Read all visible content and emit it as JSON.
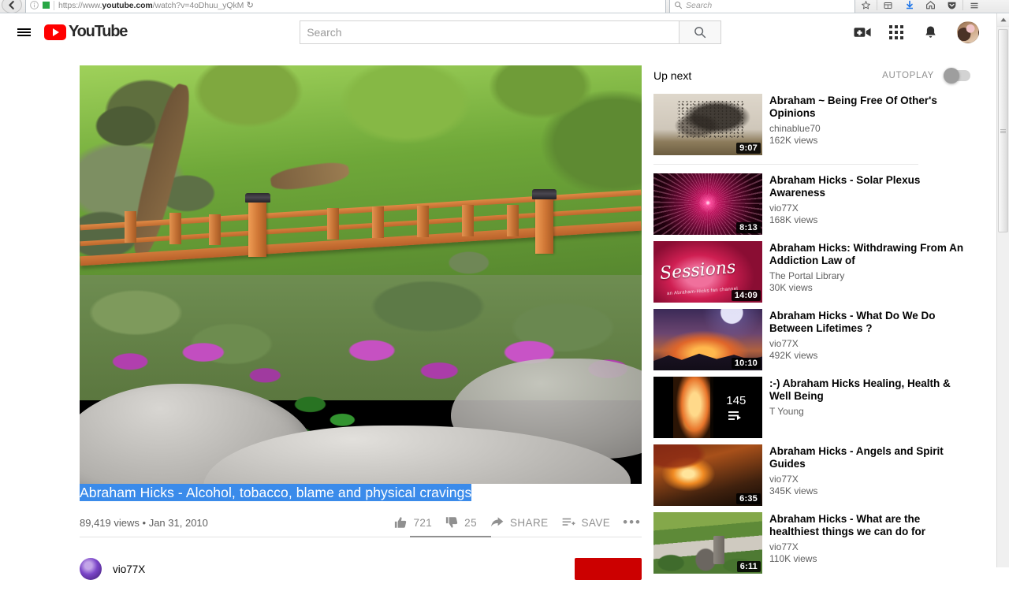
{
  "browser": {
    "url_prefix": "https://www.",
    "url_domain": "youtube.com",
    "url_path": "/watch?v=4oDhuu_yQkM",
    "reload_glyph": "↻",
    "search_placeholder": "Search",
    "icons": {
      "back": "back-arrow-icon",
      "info": "page-info-icon",
      "secure": "secure-indicator",
      "bookmark": "star-icon",
      "library": "library-icon",
      "downloads": "download-arrow-icon",
      "home": "home-icon",
      "pocket": "pocket-icon",
      "menu": "hamburger-menu-icon"
    }
  },
  "masthead": {
    "guide_label": "Guide",
    "logo_text": "YouTube",
    "search_placeholder": "Search",
    "search_value": "",
    "search_button_label": "Search",
    "create_icon": "video-camera-plus-icon",
    "apps_icon": "apps-grid-icon",
    "notifications_icon": "bell-icon",
    "avatar_label": "Account avatar"
  },
  "video": {
    "title": "Abraham Hicks - Alcohol, tobacco, blame and physical cravings",
    "views": "89,419 views",
    "separator": "•",
    "date": "Jan 31, 2010",
    "like_count": "721",
    "dislike_count": "25",
    "share_label": "SHARE",
    "save_label": "SAVE",
    "more_label": "•••",
    "channel_name": "vio77X",
    "subscribe_label": ""
  },
  "sidebar": {
    "heading": "Up next",
    "autoplay_label": "AUTOPLAY",
    "autoplay_on": false,
    "items": [
      {
        "title": "Abraham ~ Being Free Of Other's Opinions",
        "channel": "chinablue70",
        "views": "162K views",
        "duration": "9:07",
        "thumb": "birds",
        "playlist_count": ""
      },
      {
        "title": "Abraham Hicks - Solar Plexus Awareness",
        "channel": "vio77X",
        "views": "168K views",
        "duration": "8:13",
        "thumb": "plexus",
        "playlist_count": ""
      },
      {
        "title": "Abraham Hicks: Withdrawing From An Addiction Law of",
        "channel": "The Portal Library",
        "views": "30K views",
        "duration": "14:09",
        "thumb": "rose",
        "thumb_text": "Sessions",
        "thumb_subtext": "an Abraham-Hicks fan channel",
        "playlist_count": ""
      },
      {
        "title": "Abraham Hicks - What Do We Do Between Lifetimes ?",
        "channel": "vio77X",
        "views": "492K views",
        "duration": "10:10",
        "thumb": "planet",
        "playlist_count": ""
      },
      {
        "title": ":-) Abraham Hicks Healing, Health & Well Being",
        "channel": "T Young",
        "views": "",
        "duration": "",
        "thumb": "healing",
        "playlist_count": "145"
      },
      {
        "title": "Abraham Hicks - Angels and Spirit Guides",
        "channel": "vio77X",
        "views": "345K views",
        "duration": "6:35",
        "thumb": "angels",
        "playlist_count": ""
      },
      {
        "title": "Abraham Hicks - What are the healthiest things we can do for",
        "channel": "vio77X",
        "views": "110K views",
        "duration": "6:11",
        "thumb": "garden",
        "playlist_count": ""
      }
    ]
  },
  "colors": {
    "brand_red": "#ff0000",
    "subscribe_red": "#cc0000",
    "selection_blue": "#3b8bea",
    "secondary_text": "#606060",
    "primary_text": "#030303"
  }
}
